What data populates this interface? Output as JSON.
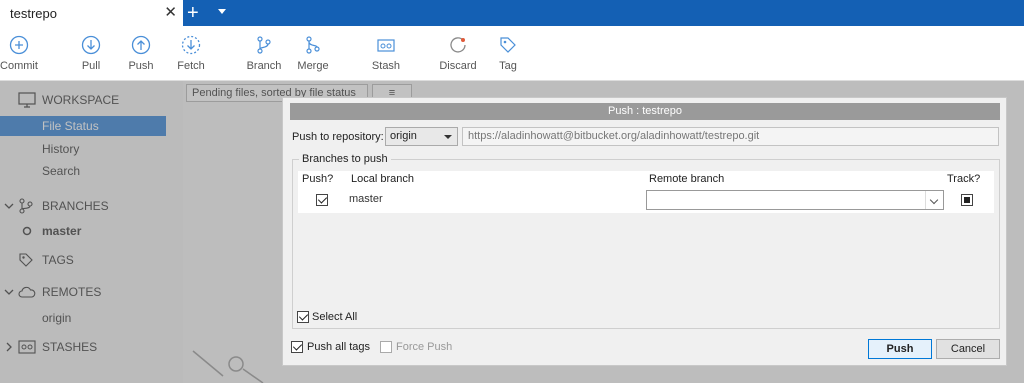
{
  "window": {
    "tab_title": "testrepo",
    "tab_close": "✕",
    "new_tab": "+"
  },
  "toolbar": {
    "commit": "Commit",
    "pull": "Pull",
    "push": "Push",
    "fetch": "Fetch",
    "branch": "Branch",
    "merge": "Merge",
    "stash": "Stash",
    "discard": "Discard",
    "tag": "Tag"
  },
  "sidebar": {
    "workspace": "WORKSPACE",
    "file_status": "File Status",
    "history": "History",
    "search": "Search",
    "branches": "BRANCHES",
    "branch_master": "master",
    "tags": "TAGS",
    "remotes": "REMOTES",
    "remote_origin": "origin",
    "stashes": "STASHES"
  },
  "main": {
    "filter": "Pending files, sorted by file status",
    "view_icon": "≡"
  },
  "dialog": {
    "title": "Push : testrepo",
    "push_to_label": "Push to repository:",
    "repo_select": "origin",
    "repo_url": "https://aladinhowatt@bitbucket.org/aladinhowatt/testrepo.git",
    "branches_group": "Branches to push",
    "col_push": "Push?",
    "col_local": "Local branch",
    "col_remote": "Remote branch",
    "col_track": "Track?",
    "rows": [
      {
        "local": "master",
        "remote": "",
        "push": true,
        "track": true
      }
    ],
    "select_all": "Select All",
    "push_all_tags": "Push all tags",
    "force_push": "Force Push",
    "push_button": "Push",
    "cancel_button": "Cancel"
  },
  "colors": {
    "accent": "#1460b4",
    "selection": "#2c7ed6"
  }
}
